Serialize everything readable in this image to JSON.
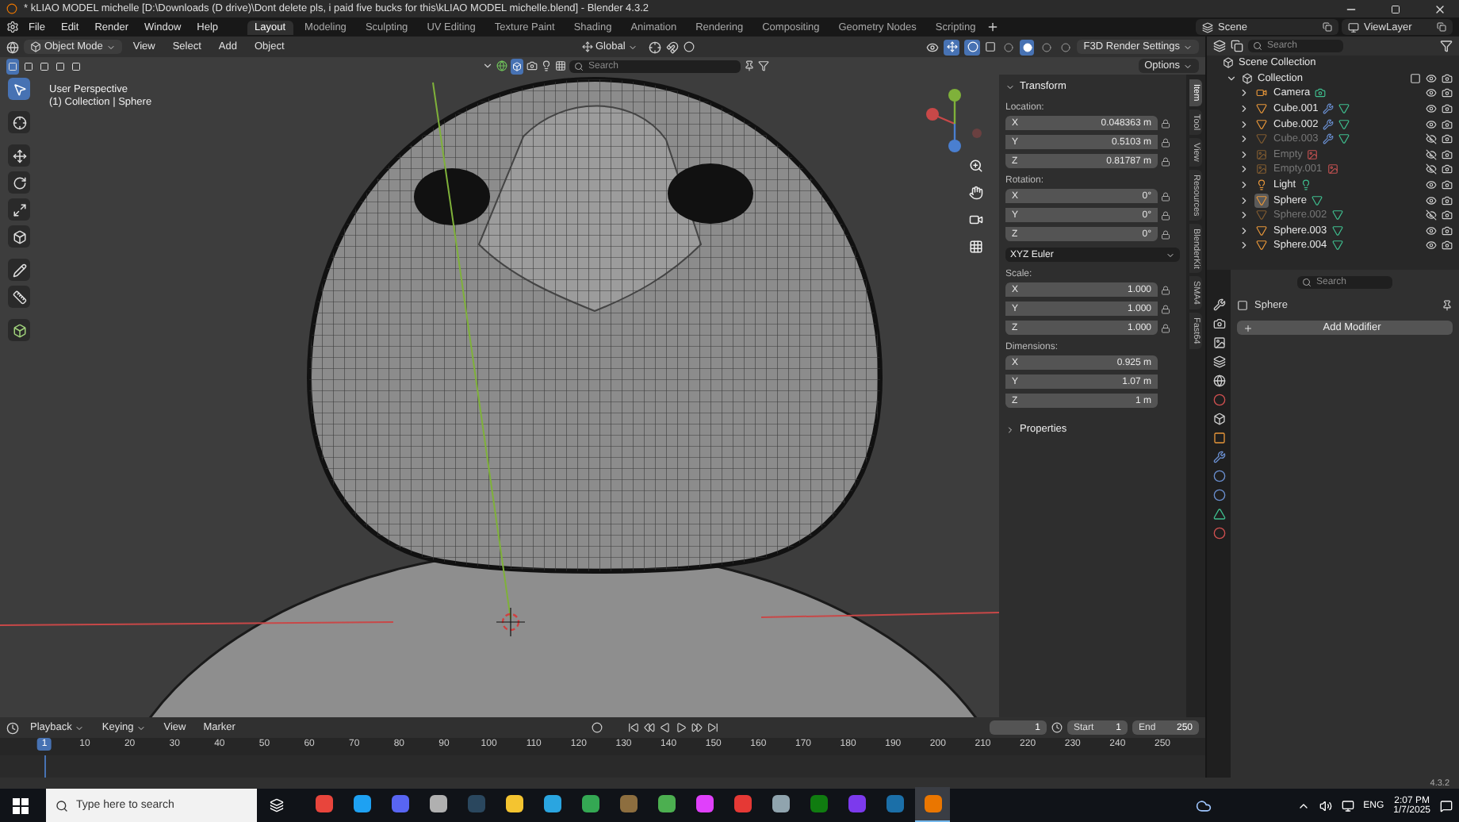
{
  "window": {
    "title": "* kLIAO MODEL michelle [D:\\Downloads (D drive)\\Dont delete pls, i paid five bucks for this\\kLIAO MODEL michelle.blend] - Blender 4.3.2"
  },
  "menu": [
    "File",
    "Edit",
    "Render",
    "Window",
    "Help"
  ],
  "workspaces": [
    {
      "label": "Layout",
      "selected": true
    },
    {
      "label": "Modeling",
      "selected": false
    },
    {
      "label": "Sculpting",
      "selected": false
    },
    {
      "label": "UV Editing",
      "selected": false
    },
    {
      "label": "Texture Paint",
      "selected": false
    },
    {
      "label": "Shading",
      "selected": false
    },
    {
      "label": "Animation",
      "selected": false
    },
    {
      "label": "Rendering",
      "selected": false
    },
    {
      "label": "Compositing",
      "selected": false
    },
    {
      "label": "Geometry Nodes",
      "selected": false
    },
    {
      "label": "Scripting",
      "selected": false
    }
  ],
  "scene": "Scene",
  "view_layer": "ViewLayer",
  "viewport": {
    "mode": "Object Mode",
    "menus": [
      "View",
      "Select",
      "Add",
      "Object"
    ],
    "orientation": "Global",
    "render_settings": "F3D Render Settings",
    "search": {
      "placeholder": "Search"
    },
    "options": "Options",
    "info": [
      "User Perspective",
      "(1) Collection | Sphere"
    ],
    "shading": [
      {
        "selected": false
      },
      {
        "selected": true
      },
      {
        "selected": false
      },
      {
        "selected": false
      }
    ]
  },
  "sidebar": {
    "tabs": [
      {
        "label": "Item",
        "selected": true
      },
      {
        "label": "Tool",
        "selected": false
      },
      {
        "label": "View",
        "selected": false
      },
      {
        "label": "Resources",
        "selected": false
      },
      {
        "label": "BlenderKit",
        "selected": false
      },
      {
        "label": "SMA4",
        "selected": false
      },
      {
        "label": "Fast64",
        "selected": false
      }
    ],
    "transform": {
      "title": "Transform",
      "groups": [
        {
          "label": "Location:",
          "lock": true,
          "rows": [
            {
              "axis": "X",
              "value": "0.048363 m"
            },
            {
              "axis": "Y",
              "value": "0.5103 m"
            },
            {
              "axis": "Z",
              "value": "0.81787 m"
            }
          ]
        },
        {
          "label": "Rotation:",
          "lock": true,
          "rows": [
            {
              "axis": "X",
              "value": "0°"
            },
            {
              "axis": "Y",
              "value": "0°"
            },
            {
              "axis": "Z",
              "value": "0°"
            }
          ],
          "mode": "XYZ Euler"
        },
        {
          "label": "Scale:",
          "lock": true,
          "rows": [
            {
              "axis": "X",
              "value": "1.000"
            },
            {
              "axis": "Y",
              "value": "1.000"
            },
            {
              "axis": "Z",
              "value": "1.000"
            }
          ]
        },
        {
          "label": "Dimensions:",
          "lock": false,
          "rows": [
            {
              "axis": "X",
              "value": "0.925 m"
            },
            {
              "axis": "Y",
              "value": "1.07 m"
            },
            {
              "axis": "Z",
              "value": "1 m"
            }
          ]
        }
      ]
    },
    "properties": "Properties"
  },
  "outliner": {
    "search": {
      "placeholder": "Search"
    },
    "root": "Scene Collection",
    "collection": {
      "name": "Collection",
      "children": [
        {
          "name": "Camera",
          "kind": "camera",
          "hidden": false,
          "selected": false,
          "modifier": false
        },
        {
          "name": "Cube.001",
          "kind": "mesh",
          "hidden": false,
          "selected": false,
          "modifier": true
        },
        {
          "name": "Cube.002",
          "kind": "mesh",
          "hidden": false,
          "selected": false,
          "modifier": true
        },
        {
          "name": "Cube.003",
          "kind": "mesh",
          "hidden": true,
          "selected": false,
          "modifier": true
        },
        {
          "name": "Empty",
          "kind": "empty",
          "hidden": true,
          "selected": false,
          "modifier": false
        },
        {
          "name": "Empty.001",
          "kind": "empty",
          "hidden": true,
          "selected": false,
          "modifier": false
        },
        {
          "name": "Light",
          "kind": "light",
          "hidden": false,
          "selected": false,
          "modifier": false
        },
        {
          "name": "Sphere",
          "kind": "mesh",
          "hidden": false,
          "selected": true,
          "modifier": false
        },
        {
          "name": "Sphere.002",
          "kind": "mesh",
          "hidden": true,
          "selected": false,
          "modifier": false
        },
        {
          "name": "Sphere.003",
          "kind": "mesh",
          "hidden": false,
          "selected": false,
          "modifier": false
        },
        {
          "name": "Sphere.004",
          "kind": "mesh",
          "hidden": false,
          "selected": false,
          "modifier": false
        }
      ]
    }
  },
  "properties": {
    "search": {
      "placeholder": "Search"
    },
    "object": "Sphere",
    "add_modifier": "Add Modifier"
  },
  "timeline": {
    "menus": [
      "Playback",
      "Keying",
      "View",
      "Marker"
    ],
    "current_frame": "1",
    "start_label": "Start",
    "start": "1",
    "end_label": "End",
    "end": "250",
    "playhead": "1",
    "ruler": [
      "10",
      "20",
      "30",
      "40",
      "50",
      "60",
      "70",
      "80",
      "90",
      "100",
      "110",
      "120",
      "130",
      "140",
      "150",
      "160",
      "170",
      "180",
      "190",
      "200",
      "210",
      "220",
      "230",
      "240",
      "250"
    ]
  },
  "status": {
    "version": "4.3.2"
  },
  "taskbar": {
    "search": {
      "placeholder": "Type here to search"
    },
    "apps": [
      {
        "color": "#e8453c",
        "selected": false
      },
      {
        "color": "#1ea1f2",
        "selected": false
      },
      {
        "color": "#5865f2",
        "selected": false
      },
      {
        "color": "#b0b0b0",
        "selected": false
      },
      {
        "color": "#2a475e",
        "selected": false
      },
      {
        "color": "#f4c430",
        "selected": false
      },
      {
        "color": "#2aa5e0",
        "selected": false
      },
      {
        "color": "#34a853",
        "selected": false
      },
      {
        "color": "#8d6e3f",
        "selected": false
      },
      {
        "color": "#4caf50",
        "selected": false
      },
      {
        "color": "#e040fb",
        "selected": false
      },
      {
        "color": "#e53935",
        "selected": false
      },
      {
        "color": "#90a4ae",
        "selected": false
      },
      {
        "color": "#107c10",
        "selected": false
      },
      {
        "color": "#7c3aed",
        "selected": false
      },
      {
        "color": "#1b6fa8",
        "selected": false
      },
      {
        "color": "#ea7600",
        "selected": true
      }
    ],
    "tray": {
      "language": "ENG",
      "time": "2:07 PM",
      "date": "1/7/2025"
    }
  }
}
